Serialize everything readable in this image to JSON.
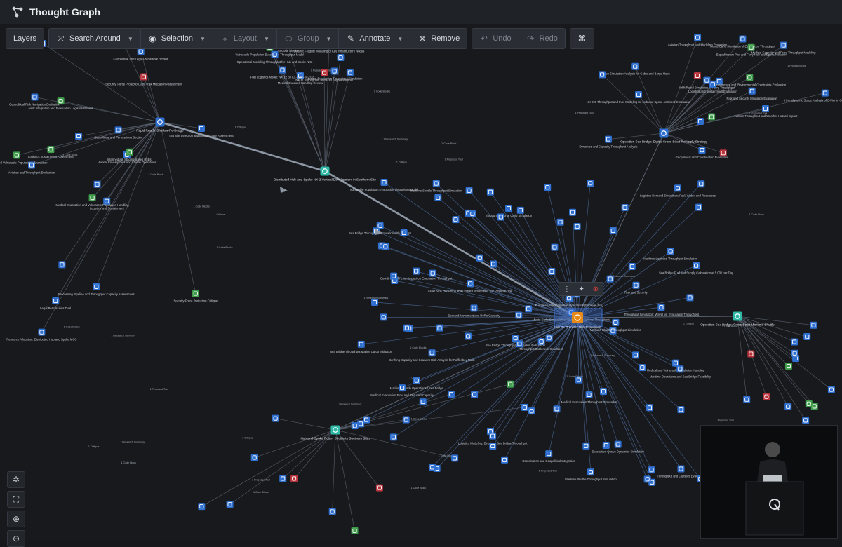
{
  "app": {
    "title": "Thought Graph"
  },
  "toolbar": {
    "layers": "Layers",
    "search_around": "Search Around",
    "selection": "Selection",
    "layout": "Layout",
    "group": "Group",
    "annotate": "Annotate",
    "remove": "Remove",
    "undo": "Undo",
    "redo": "Redo"
  },
  "colors": {
    "background": "#17191d",
    "node_blue": "#2f6fcf",
    "node_red": "#b7323a",
    "node_green": "#3d9b4a",
    "node_teal": "#2fb9a6",
    "node_orange": "#e58a16",
    "edge": "#5c6470",
    "selection": "#3c6fd0"
  },
  "graph": {
    "hubs": [
      {
        "id": "h1",
        "kind": "blue",
        "label": "Rapid Reach: Shallow-Re-Bridge"
      },
      {
        "id": "h2",
        "kind": "teal",
        "label": "Distributed Hub-and-Spoke NX-2 Vertical Development in Southern Site"
      },
      {
        "id": "h3",
        "kind": "blue",
        "label": "Operation Sea Bridge: Digital Cross-Strait Resupply Strategy"
      },
      {
        "id": "h4",
        "kind": "orange",
        "label": "Hub Re-Transfer Risk Evaluation"
      },
      {
        "id": "h5",
        "kind": "teal",
        "label": "Operation Sea Bridge: Cross-Strait Maritime Shuttle"
      },
      {
        "id": "h6",
        "kind": "teal",
        "label": "Hub-and-Spoke Rotary Shuttle to Southern Sites"
      }
    ],
    "labels": [
      "Logistics and Sustainment",
      "Vertical Envelopment and Shuttle Operations",
      "Geopolitical and Legal Framework Review",
      "Security, Force Protection, and Risk Mitigation Assessment",
      "Aviation and Throughput Evaluation",
      "Medical Evacuation and Vulnerable Population Handling",
      "Resource Allocation: Distributed Hub and Spoke MCC",
      "Geopolitical and Permissions Section",
      "Legal Permissions Dual",
      "Intermediate Staging Bases (ISBs)",
      "Geopolitical Risk Navigation Evaluation",
      "Medical and Vulnerable Populations Evaluation",
      "ISB Site Selection and Infrastructure Assessment",
      "Processing Pipeline and Throughput Capacity Assessment",
      "Airlift Integration and Evacuation Logistics Review",
      "Security Force Protection Critique",
      "Geospatial Infrastructure Analysis",
      "Logistics Sustainment Assessment",
      "Medical Evacuee Handling Review",
      "NX-11 Throughput and Fuel Logistics Model",
      "Fuel Logistics Model: NX-12 on KX-218 Fed ECS",
      "Vulnerable Population Evacuation Throughput Model",
      "AI Code Blocks",
      "Medical Evacuation Throughput Simulation",
      "Seismic Fragility Modeling of Key Infrastructure Nodes",
      "Operational Modeling Throughput for Hub and Spoke NX3",
      "Medical Capacity and Ferry Throughput Modeling",
      "Monte Carlo Simulation of Evacuation Throughput",
      "Airlift Rapid Simulation of Ferry Throughput",
      "Aviation Throughput and Weather Hazard Impact",
      "Dynamics and Capacity Throughput Analysis",
      "Option Simulation Analysis for Cable and Barge Hubs",
      "Risk and Security Mitigation Evaluation",
      "Geopolitical and Coordination Evaluation",
      "Aviation Throughput and Modeling Evaluation",
      "Infrastructure and Environmental Constraints Evaluation",
      "Logistics and Sustainment Evaluation",
      "Expeditionary Pier and Ferry Hub and Spoke Network",
      "NX-228 Throughput and Fuel Modeling for Hub and Spoke on Direct Evacuation",
      "Hydrodynamic Surge Analysis of E-Pier in Geophonic Currents",
      "Maritime Shuttle Operations / Sea Bridge",
      "Medical and Vulnerable Population Handling",
      "Demand Movement and RoRo Capacity",
      "Coordination and Geopolitical Integration",
      "Sea Bridge Throughput Marine Cargo Mitigation",
      "Sea Bridge Fuel and Supply Calculation at 5,000 per Day",
      "Maritime Operations and Sea Bridge Feasibility",
      "Asian Side Reception and Onward Movement: The Possible Risk",
      "European Side Collection Operations (Package EIA)",
      "Throughput Monte Carlo Simulation",
      "Vulnerable Population Evacuation Throughput Model",
      "Maritime Shuttle Throughput Simulation",
      "Logistics Demand Simulation: Fuel, Water, and Resources",
      "Medical Evacuation Flow and Reduced Capacity",
      "Throughput Bottleneck Simulation",
      "Sea Bridge Throughput Simulation with Holdups",
      "Sea Bridge Throughput Simulation Evaluation",
      "Maritime Shuttle Throughput Simulation",
      "Monte Carlo Simulation of Sea Bridge Maritime Throughput",
      "Throughput Simulation: Wavel vs. Evacuation Throughput",
      "Maritime Shuttle Throughput Simulation",
      "Logistics Modeling: Direct vs. Sea Bridge Throughput",
      "Evacuation Queue Dynamics Simulation",
      "Coordination Friction Impact on Evacuation Throughput",
      "Berthing Capacity and Seawork Risk Analysis for Rafflesbey Node",
      "Medical Evacuation Throughput Simulation",
      "Maritime Logistics Throughput Simulation",
      "Risk and Security",
      "Throughput and Logistics Evaluation"
    ],
    "edge_labels": [
      "1 Code Block",
      "1 Proposed Tool",
      "1 Research Summary",
      "1 Critique",
      "1 Code Blocks"
    ]
  }
}
